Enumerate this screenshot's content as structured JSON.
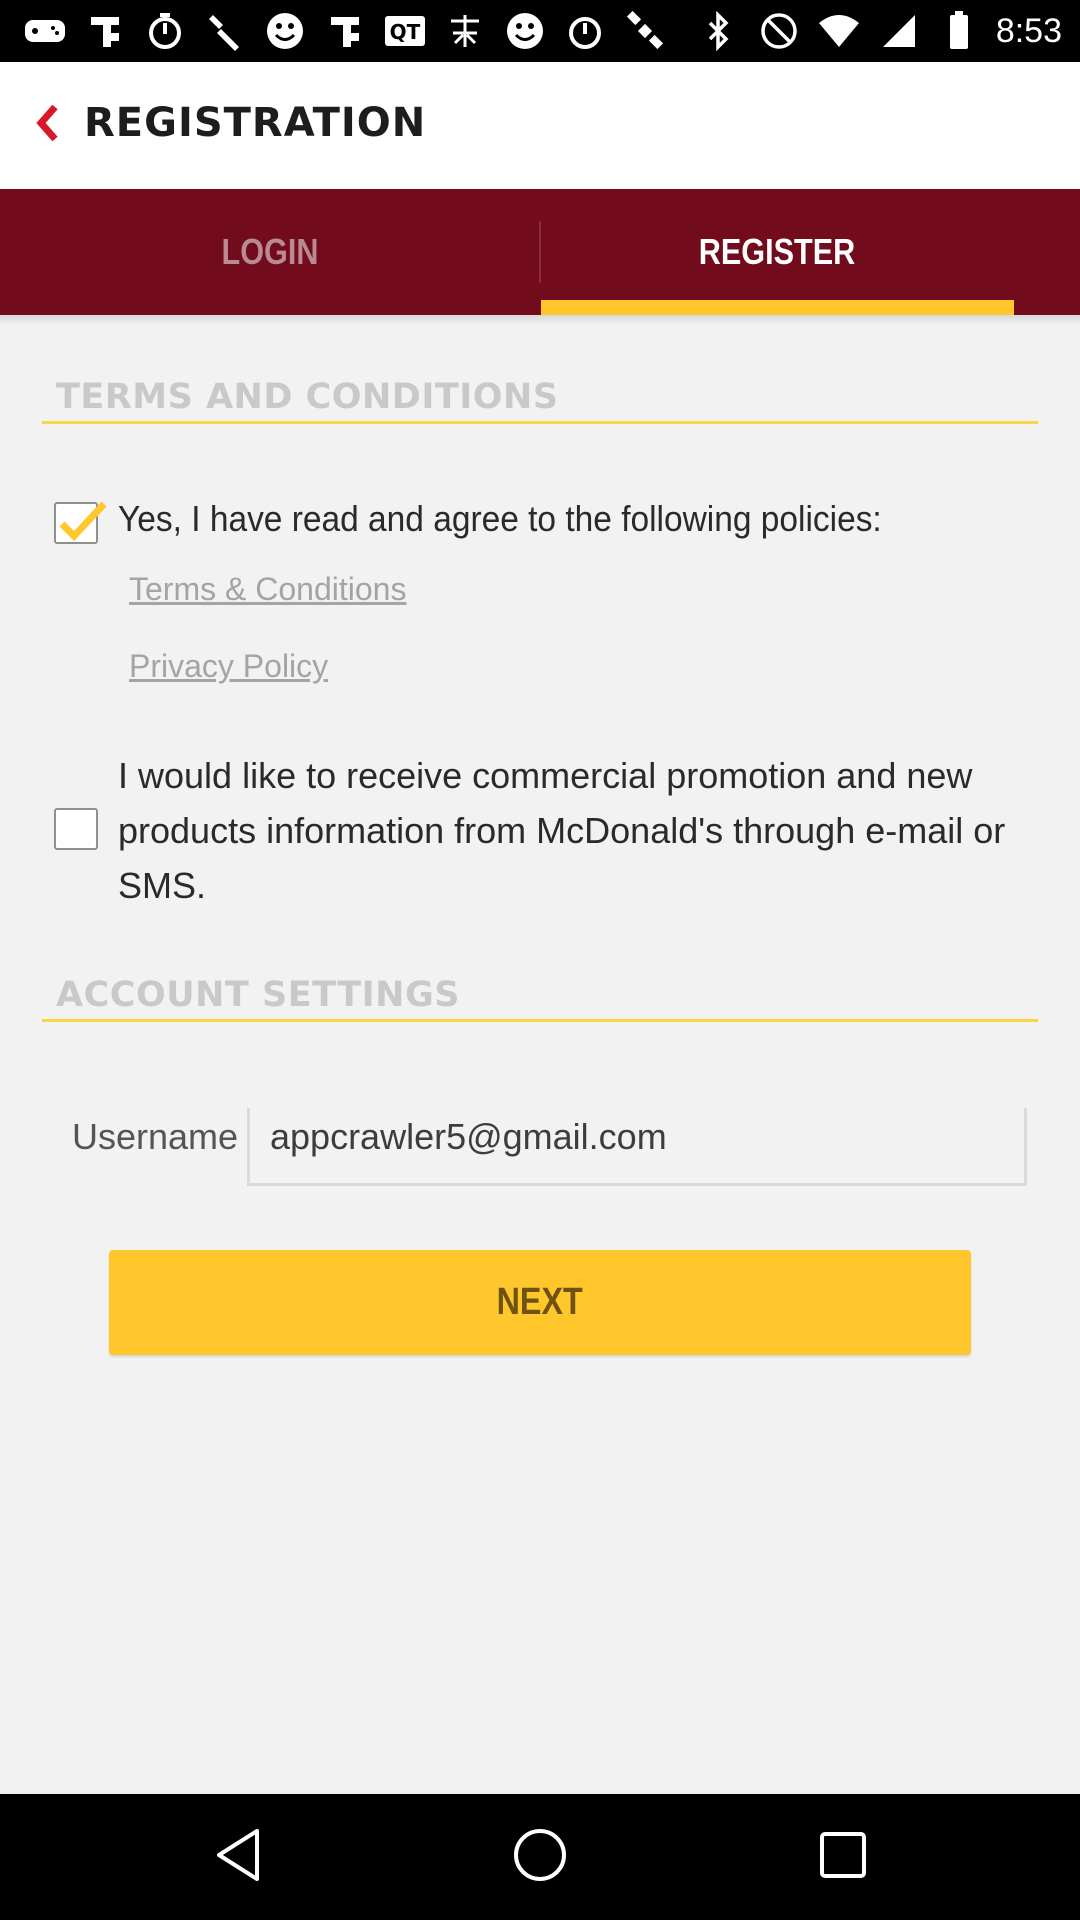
{
  "status_bar": {
    "time": "8:53",
    "left_icons": [
      "game-controller-icon",
      "fan-icon",
      "timer-icon",
      "wrench-icon",
      "smiley-icon",
      "fan-icon",
      "qt-icon",
      "chinese-char-icon",
      "smiley-icon",
      "timer-icon",
      "satellite-icon"
    ],
    "right_icons": [
      "bluetooth-icon",
      "mute-icon",
      "wifi-icon",
      "signal-icon",
      "battery-icon"
    ]
  },
  "app_bar": {
    "title": "REGISTRATION"
  },
  "tabs": [
    {
      "label": "LOGIN",
      "active": false
    },
    {
      "label": "REGISTER",
      "active": true
    }
  ],
  "terms": {
    "header": "TERMS AND CONDITIONS",
    "agree_checked": true,
    "agree_text": "Yes, I have read and agree to the following policies:",
    "links": [
      "Terms & Conditions",
      "Privacy Policy"
    ],
    "promo_checked": false,
    "promo_text": "I would like to receive commercial promotion and new products information from McDonald's through e-mail or SMS."
  },
  "account": {
    "header": "ACCOUNT SETTINGS",
    "username_label": "Username",
    "username_value": "appcrawler5@gmail.com"
  },
  "next_button": {
    "label": "NEXT"
  },
  "colors": {
    "tab_bar": "#720b1b",
    "accent_yellow": "#ffc72c",
    "back_arrow": "#d7182a"
  }
}
